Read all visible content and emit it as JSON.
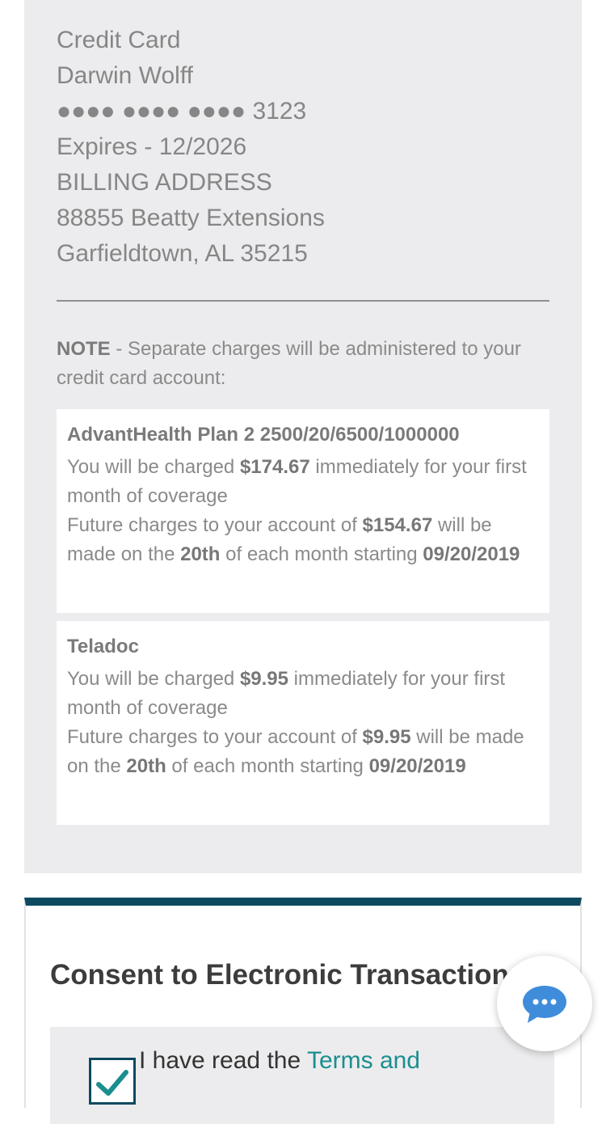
{
  "payment": {
    "method": "Credit Card",
    "name": "Darwin Wolff",
    "card_number": "●●●● ●●●● ●●●● 3123",
    "expires": "Expires - 12/2026",
    "billing_label": "BILLING ADDRESS",
    "address_line1": "88855 Beatty Extensions",
    "address_line2": "Garfieldtown, AL 35215"
  },
  "note": {
    "label": "NOTE",
    "text": " - Separate charges will be administered to your credit card account:"
  },
  "plans": [
    {
      "name": "AdvantHealth Plan 2 2500/20/6500/1000000",
      "t1": "You will be charged ",
      "immediate": "$174.67",
      "t2": " immediately for your first month of coverage",
      "t3": "Future charges to your account of ",
      "future": "$154.67",
      "t4": " will be made on the ",
      "day": "20th",
      "t5": " of each month starting ",
      "start": "09/20/2019"
    },
    {
      "name": "Teladoc",
      "t1": "You will be charged ",
      "immediate": "$9.95",
      "t2": " immediately for your first month of coverage",
      "t3": "Future charges to your account of ",
      "future": "$9.95",
      "t4": " will be made on the ",
      "day": "20th",
      "t5": " of each month starting ",
      "start": "09/20/2019"
    }
  ],
  "consent": {
    "title": "Consent to Electronic Transactions",
    "text_prefix": "I have read the ",
    "link_text": "Terms and",
    "checked": true
  },
  "icons": {
    "chat": "chat-bubble-icon",
    "check": "checkmark-icon"
  },
  "colors": {
    "accent_dark": "#0d4a60",
    "link": "#1b8e8e",
    "chat_blue": "#3f8cdb"
  }
}
